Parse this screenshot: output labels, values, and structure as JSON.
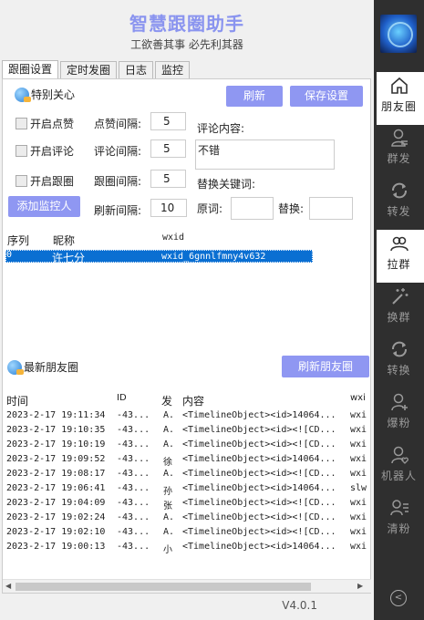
{
  "app": {
    "title": "智慧跟圈助手",
    "subtitle": "工欲善其事 必先利其器",
    "version": "V4.0.1"
  },
  "tabs": [
    {
      "label": "跟圈设置",
      "active": true
    },
    {
      "label": "定时发圈",
      "active": false
    },
    {
      "label": "日志",
      "active": false
    },
    {
      "label": "监控",
      "active": false
    }
  ],
  "settings": {
    "section_title": "特别关心",
    "refresh_button": "刷新",
    "save_button": "保存设置",
    "checks": [
      {
        "label": "开启点赞",
        "checked": false
      },
      {
        "label": "开启评论",
        "checked": false
      },
      {
        "label": "开启跟圈",
        "checked": false
      }
    ],
    "intervals": [
      {
        "label": "点赞间隔:",
        "value": "5"
      },
      {
        "label": "评论间隔:",
        "value": "5"
      },
      {
        "label": "跟圈间隔:",
        "value": "5"
      },
      {
        "label": "刷新间隔:",
        "value": "10"
      }
    ],
    "add_monitor_button": "添加监控人",
    "comment_label": "评论内容:",
    "comment_value": "不错",
    "replace_label": "替换关键词:",
    "original_label": "原词:",
    "original_value": "",
    "replace_with_label": "替换:",
    "replace_with_value": ""
  },
  "monitor_table": {
    "columns": [
      "序列",
      "昵称",
      "wxid"
    ],
    "rows": [
      {
        "index": "0",
        "nickname": "许七分",
        "wxid": "wxid_6gnnlfmny4v632"
      }
    ]
  },
  "moments": {
    "section_title": "最新朋友圈",
    "refresh_button": "刷新朋友圈",
    "columns": [
      "时间",
      "ID",
      "发",
      "内容",
      "wxi"
    ],
    "rows": [
      {
        "time": "2023-2-17 19:11:34",
        "id": "-43...",
        "sender": "A.",
        "content": "<TimelineObject><id>14064...",
        "wxid": "wxi"
      },
      {
        "time": "2023-2-17 19:10:35",
        "id": "-43...",
        "sender": "A.",
        "content": "<TimelineObject><id><![CD...",
        "wxid": "wxi"
      },
      {
        "time": "2023-2-17 19:10:19",
        "id": "-43...",
        "sender": "A.",
        "content": "<TimelineObject><id><![CD...",
        "wxid": "wxi"
      },
      {
        "time": "2023-2-17 19:09:52",
        "id": "-43...",
        "sender": "徐",
        "content": "<TimelineObject><id>14064...",
        "wxid": "wxi"
      },
      {
        "time": "2023-2-17 19:08:17",
        "id": "-43...",
        "sender": "A.",
        "content": "<TimelineObject><id><![CD...",
        "wxid": "wxi"
      },
      {
        "time": "2023-2-17 19:06:41",
        "id": "-43...",
        "sender": "孙",
        "content": "<TimelineObject><id>14064...",
        "wxid": "slw"
      },
      {
        "time": "2023-2-17 19:04:09",
        "id": "-43...",
        "sender": "张",
        "content": "<TimelineObject><id><![CD...",
        "wxid": "wxi"
      },
      {
        "time": "2023-2-17 19:02:24",
        "id": "-43...",
        "sender": "A.",
        "content": "<TimelineObject><id><![CD...",
        "wxid": "wxi"
      },
      {
        "time": "2023-2-17 19:02:10",
        "id": "-43...",
        "sender": "A.",
        "content": "<TimelineObject><id><![CD...",
        "wxid": "wxi"
      },
      {
        "time": "2023-2-17 19:00:13",
        "id": "-43...",
        "sender": "小",
        "content": "<TimelineObject><id>14064...",
        "wxid": "wxi"
      }
    ]
  },
  "sidebar": {
    "items": [
      {
        "label": "朋友圈",
        "icon": "home-icon",
        "active": true
      },
      {
        "label": "群发",
        "icon": "broadcast-user-icon",
        "active": false
      },
      {
        "label": "转发",
        "icon": "refresh-icon",
        "active": false
      },
      {
        "label": "拉群",
        "icon": "group-icon",
        "active": true
      },
      {
        "label": "换群",
        "icon": "magic-wand-icon",
        "active": false
      },
      {
        "label": "转换",
        "icon": "convert-icon",
        "active": false
      },
      {
        "label": "爆粉",
        "icon": "add-user-icon",
        "active": false
      },
      {
        "label": "机器人",
        "icon": "robot-heart-icon",
        "active": false
      },
      {
        "label": "清粉",
        "icon": "user-list-icon",
        "active": false
      }
    ]
  },
  "colors": {
    "accent": "#8f97f2",
    "title": "#8a94ef",
    "selection": "#0a6fd2",
    "sidebar": "#2f2f2f"
  }
}
